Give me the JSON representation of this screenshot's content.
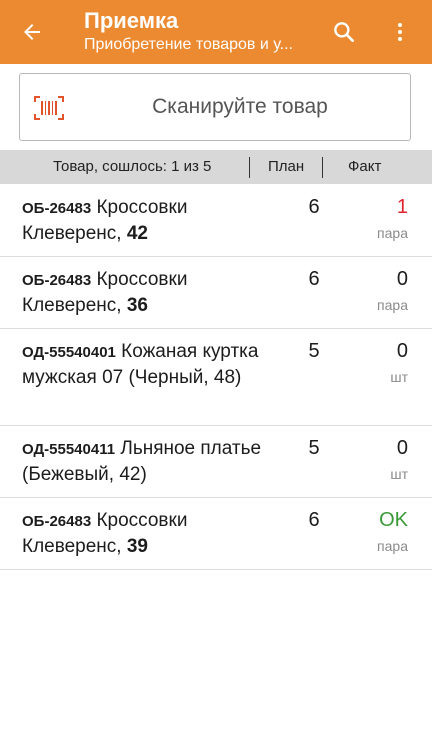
{
  "appbar": {
    "title": "Приемка",
    "subtitle": "Приобретение товаров и у...",
    "back_icon": "arrow-left",
    "search_icon": "search",
    "more_icon": "more-vertical",
    "color": "#ec8a31"
  },
  "scan": {
    "label": "Сканируйте товар",
    "icon": "barcode"
  },
  "table": {
    "header_item": "Товар, сошлось: 1 из 5",
    "header_plan": "План",
    "header_fact": "Факт"
  },
  "items": [
    {
      "code": "ОБ-26483",
      "name": "Кроссовки Клеверенс,",
      "variant": "42",
      "plan": "6",
      "fact": "1",
      "unit": "пара",
      "status": "over"
    },
    {
      "code": "ОБ-26483",
      "name": "Кроссовки Клеверенс,",
      "variant": "36",
      "plan": "6",
      "fact": "0",
      "unit": "пара",
      "status": "normal"
    },
    {
      "code": "ОД-55540401",
      "name": "Кожаная куртка мужская 07 (Черный, 48)",
      "variant": "",
      "plan": "5",
      "fact": "0",
      "unit": "шт",
      "status": "normal"
    },
    {
      "code": "ОД-55540411",
      "name": "Льняное платье (Бежевый, 42)",
      "variant": "",
      "plan": "5",
      "fact": "0",
      "unit": "шт",
      "status": "normal"
    },
    {
      "code": "ОБ-26483",
      "name": "Кроссовки Клеверенс,",
      "variant": "39",
      "plan": "6",
      "fact": "OK",
      "unit": "пара",
      "status": "ok"
    }
  ]
}
